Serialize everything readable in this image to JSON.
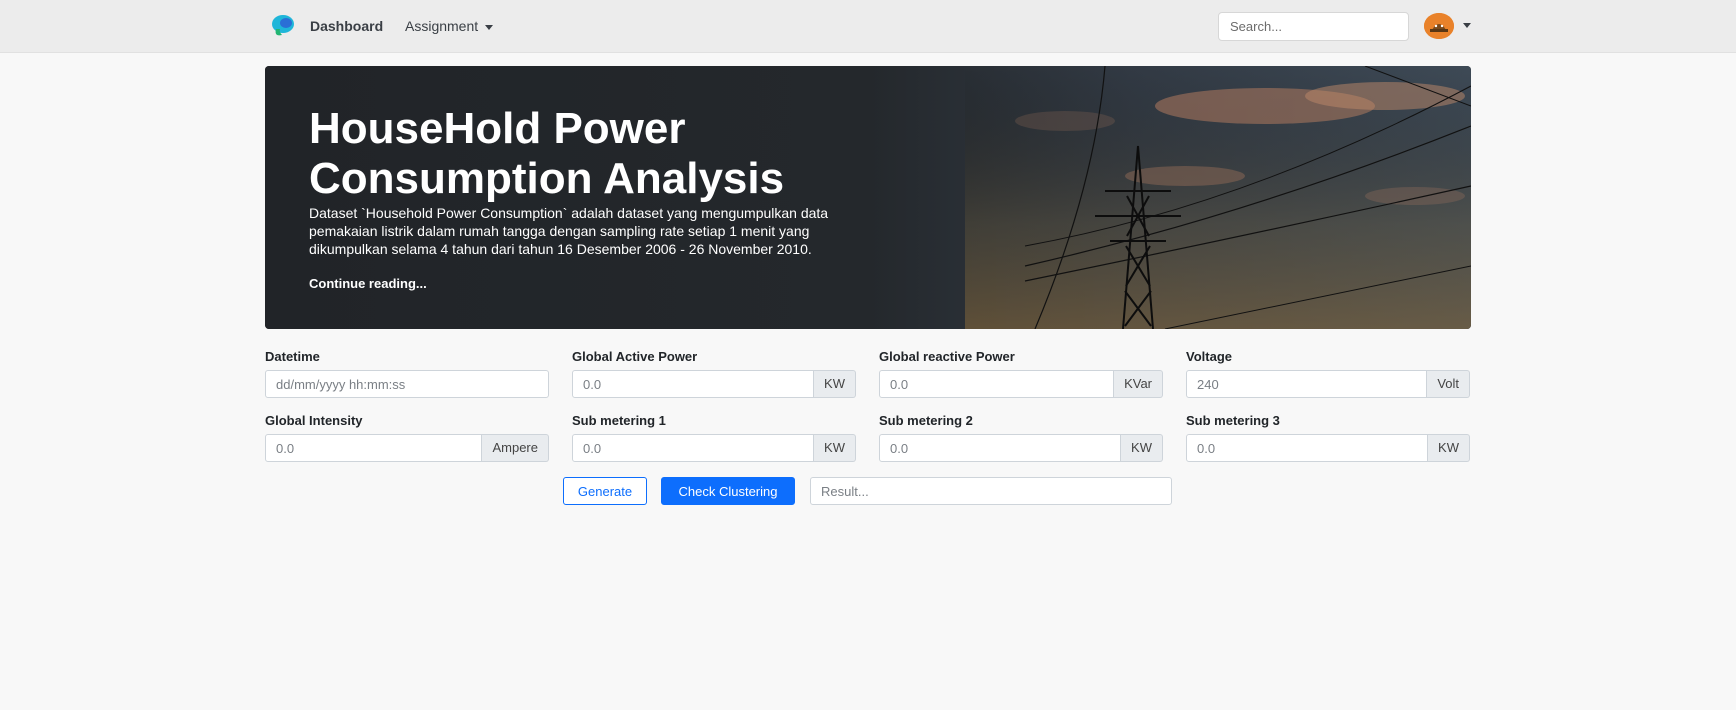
{
  "navbar": {
    "brand_label": "Dashboard",
    "assignment_label": "Assignment",
    "search_placeholder": "Search..."
  },
  "hero": {
    "title_line1": "HouseHold Power",
    "title_line2": "Consumption Analysis",
    "description": "Dataset `Household Power Consumption` adalah dataset yang mengumpulkan data pemakaian listrik dalam rumah tangga dengan sampling rate setiap 1 menit yang dikumpulkan selama 4 tahun dari tahun 16 Desember 2006 - 26 November 2010.",
    "link_label": "Continue reading..."
  },
  "form": {
    "datetime": {
      "label": "Datetime",
      "placeholder": "dd/mm/yyyy hh:mm:ss"
    },
    "global_active_power": {
      "label": "Global Active Power",
      "placeholder": "0.0",
      "unit": "KW"
    },
    "global_reactive_power": {
      "label": "Global reactive Power",
      "placeholder": "0.0",
      "unit": "KVar"
    },
    "voltage": {
      "label": "Voltage",
      "placeholder": "240",
      "unit": "Volt"
    },
    "global_intensity": {
      "label": "Global Intensity",
      "placeholder": "0.0",
      "unit": "Ampere"
    },
    "sub_metering_1": {
      "label": "Sub metering 1",
      "placeholder": "0.0",
      "unit": "KW"
    },
    "sub_metering_2": {
      "label": "Sub metering 2",
      "placeholder": "0.0",
      "unit": "KW"
    },
    "sub_metering_3": {
      "label": "Sub metering 3",
      "placeholder": "0.0",
      "unit": "KW"
    }
  },
  "actions": {
    "generate_label": "Generate",
    "check_label": "Check Clustering",
    "result_placeholder": "Result..."
  },
  "colors": {
    "primary": "#0d6efd",
    "navbar_bg": "#ececec",
    "hero_bg": "#212428",
    "avatar": "#e9822a"
  },
  "icons": [
    "brand-logo-icon",
    "chevron-down-icon",
    "avatar-icon"
  ]
}
